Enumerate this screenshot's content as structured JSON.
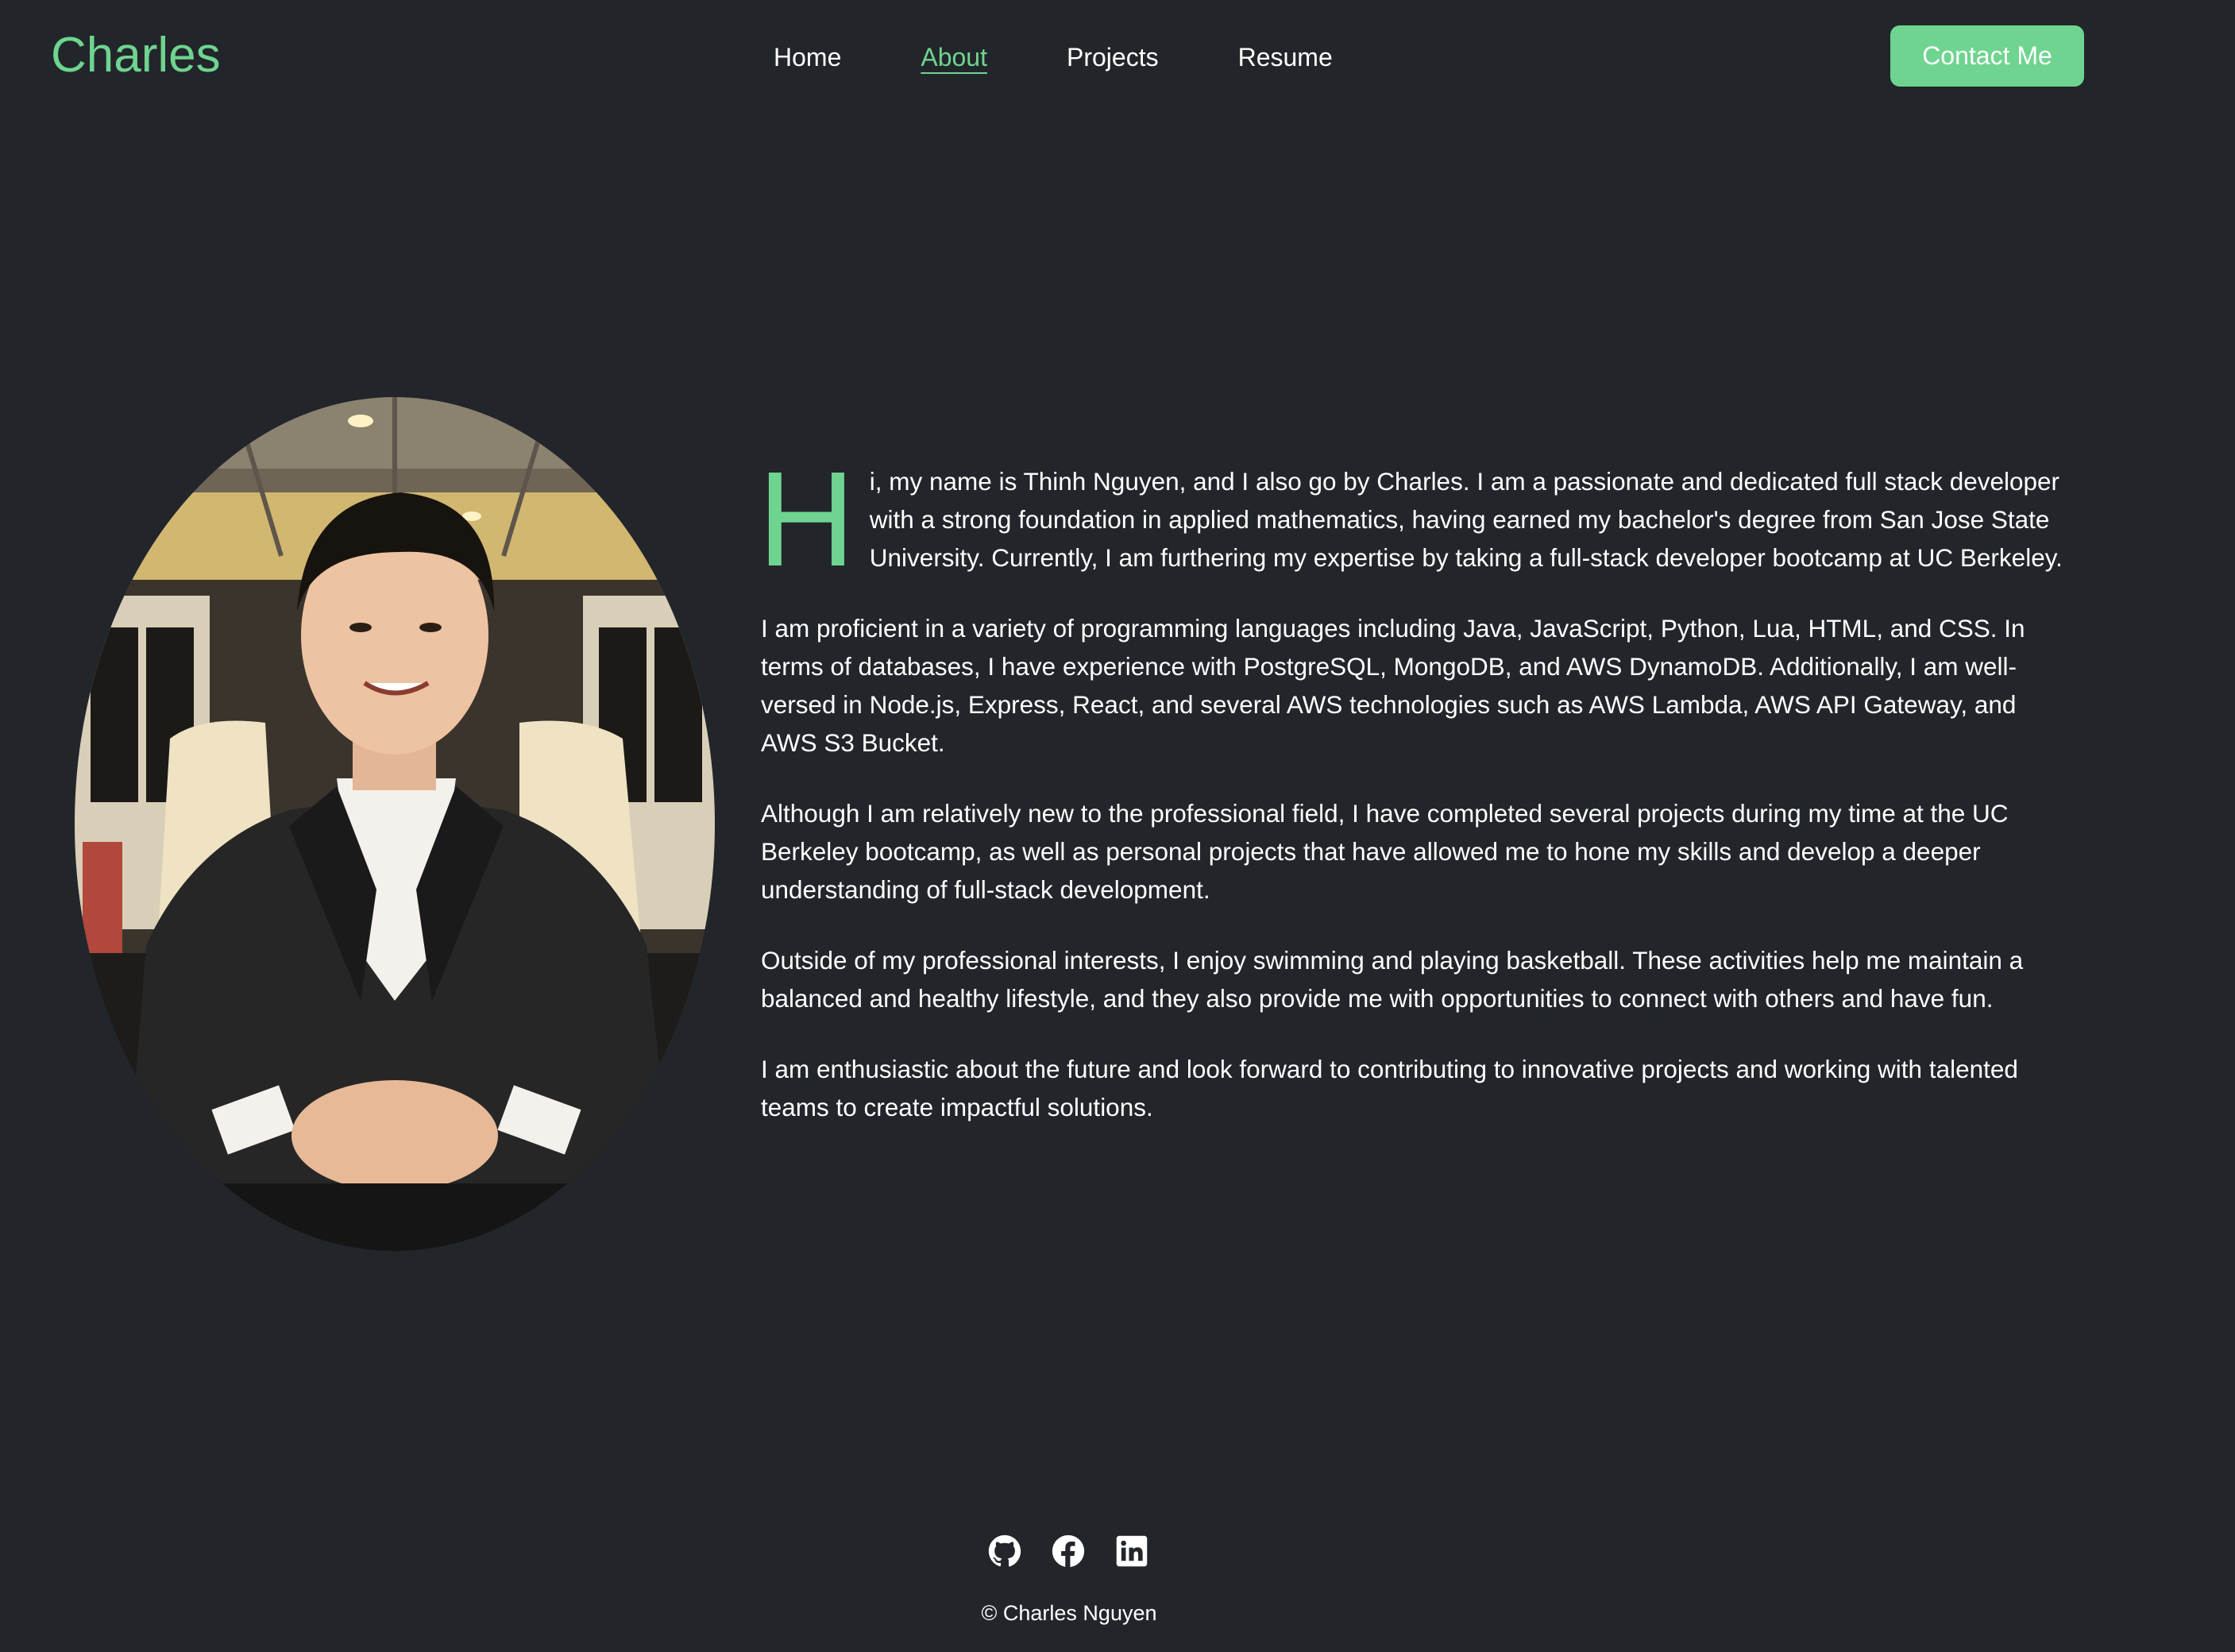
{
  "header": {
    "brand": "Charles",
    "nav": [
      {
        "label": "Home"
      },
      {
        "label": "About"
      },
      {
        "label": "Projects"
      },
      {
        "label": "Resume"
      }
    ],
    "contact_label": "Contact Me"
  },
  "about": {
    "dropcap": "H",
    "first_paragraph_rest": "i, my name is Thinh Nguyen, and I also go by Charles. I am a passionate and dedicated full stack developer with a strong foundation in applied mathematics, having earned my bachelor's degree from San Jose State University. Currently, I am furthering my expertise by taking a full-stack developer bootcamp at UC Berkeley.",
    "paragraphs": [
      "I am proficient in a variety of programming languages including Java, JavaScript, Python, Lua, HTML, and CSS. In terms of databases, I have experience with PostgreSQL, MongoDB, and AWS DynamoDB. Additionally, I am well-versed in Node.js, Express, React, and several AWS technologies such as AWS Lambda, AWS API Gateway, and AWS S3 Bucket.",
      "Although I am relatively new to the professional field, I have completed several projects during my time at the UC Berkeley bootcamp, as well as personal projects that have allowed me to hone my skills and develop a deeper understanding of full-stack development.",
      "Outside of my professional interests, I enjoy swimming and playing basketball. These activities help me maintain a balanced and healthy lifestyle, and they also provide me with opportunities to connect with others and have fun.",
      "I am enthusiastic about the future and look forward to contributing to innovative projects and working with talented teams to create impactful solutions."
    ]
  },
  "footer": {
    "social_icons": [
      "github-icon",
      "facebook-icon",
      "linkedin-icon"
    ],
    "copyright": "© Charles Nguyen"
  },
  "colors": {
    "background": "#22262b",
    "accent": "#6fd48f",
    "text": "#ffffff"
  }
}
